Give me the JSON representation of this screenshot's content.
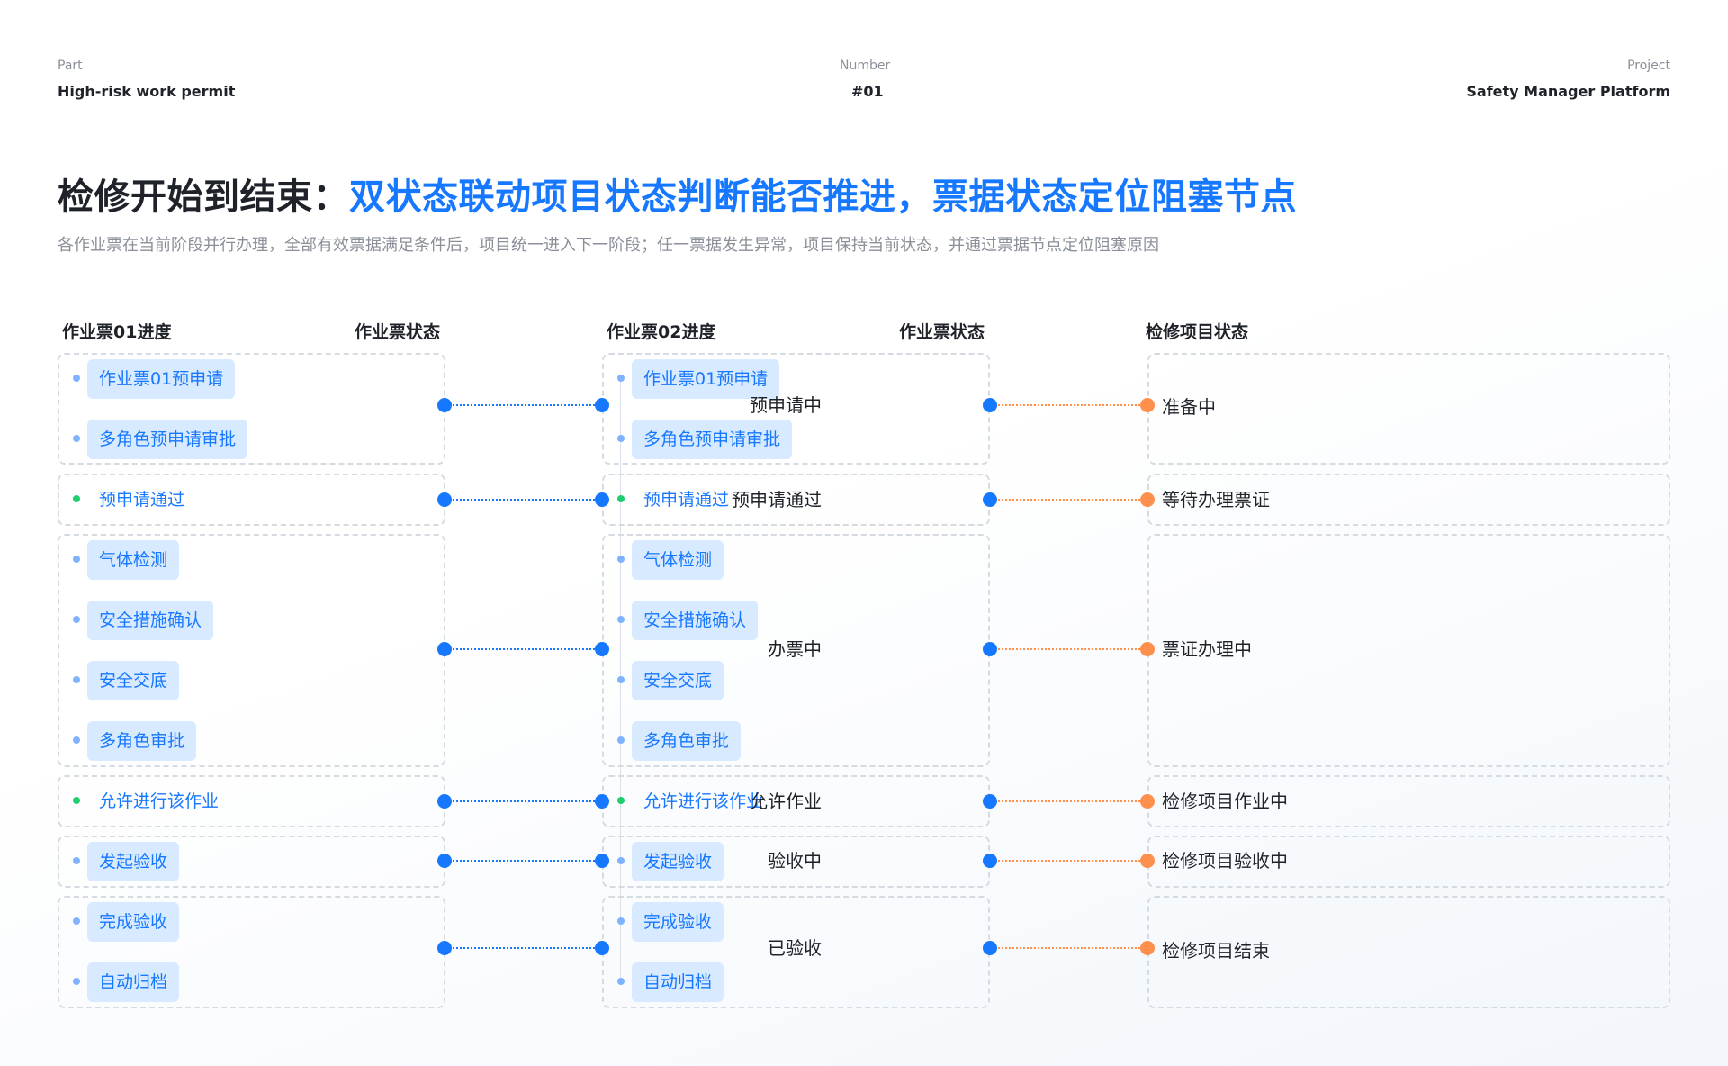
{
  "header": {
    "part_label": "Part",
    "part_value": "High-risk work permit",
    "number_label": "Number",
    "number_value": "#01",
    "project_label": "Project",
    "project_value": "Safety Manager Platform"
  },
  "title": {
    "lead": "检修开始到结束：",
    "highlight": "双状态联动项目状态判断能否推进，票据状态定位阻塞节点"
  },
  "subtitle": "各作业票在当前阶段并行办理，全部有效票据满足条件后，项目统一进入下一阶段；任一票据发生异常，项目保持当前状态，并通过票据节点定位阻塞原因",
  "columns": {
    "ticket01_progress": "作业票01进度",
    "ticket01_status": "作业票状态",
    "ticket02_progress": "作业票02进度",
    "ticket02_status": "作业票状态",
    "project_status": "检修项目状态"
  },
  "ticket01": {
    "steps": [
      "作业票01预申请",
      "多角色预申请审批",
      "预申请通过",
      "气体检测",
      "安全措施确认",
      "安全交底",
      "多角色审批",
      "允许进行该作业",
      "发起验收",
      "完成验收",
      "自动归档"
    ]
  },
  "ticket02": {
    "steps": [
      "作业票01预申请",
      "多角色预申请审批",
      "预申请通过",
      "气体检测",
      "安全措施确认",
      "安全交底",
      "多角色审批",
      "允许进行该作业",
      "发起验收",
      "完成验收",
      "自动归档"
    ]
  },
  "ticket_status": [
    "预申请中",
    "预申请通过",
    "办票中",
    "允许作业",
    "验收中",
    "已验收"
  ],
  "project_status": [
    "准备中",
    "等待办理票证",
    "票证办理中",
    "检修项目作业中",
    "检修项目验收中",
    "检修项目结束"
  ],
  "colors": {
    "accent": "#1677ff",
    "pill_bg": "#d8eaff",
    "milestone": "#1fcf6f",
    "project_dot": "#ff8f4d",
    "dashed_border": "#d6dbe1"
  }
}
